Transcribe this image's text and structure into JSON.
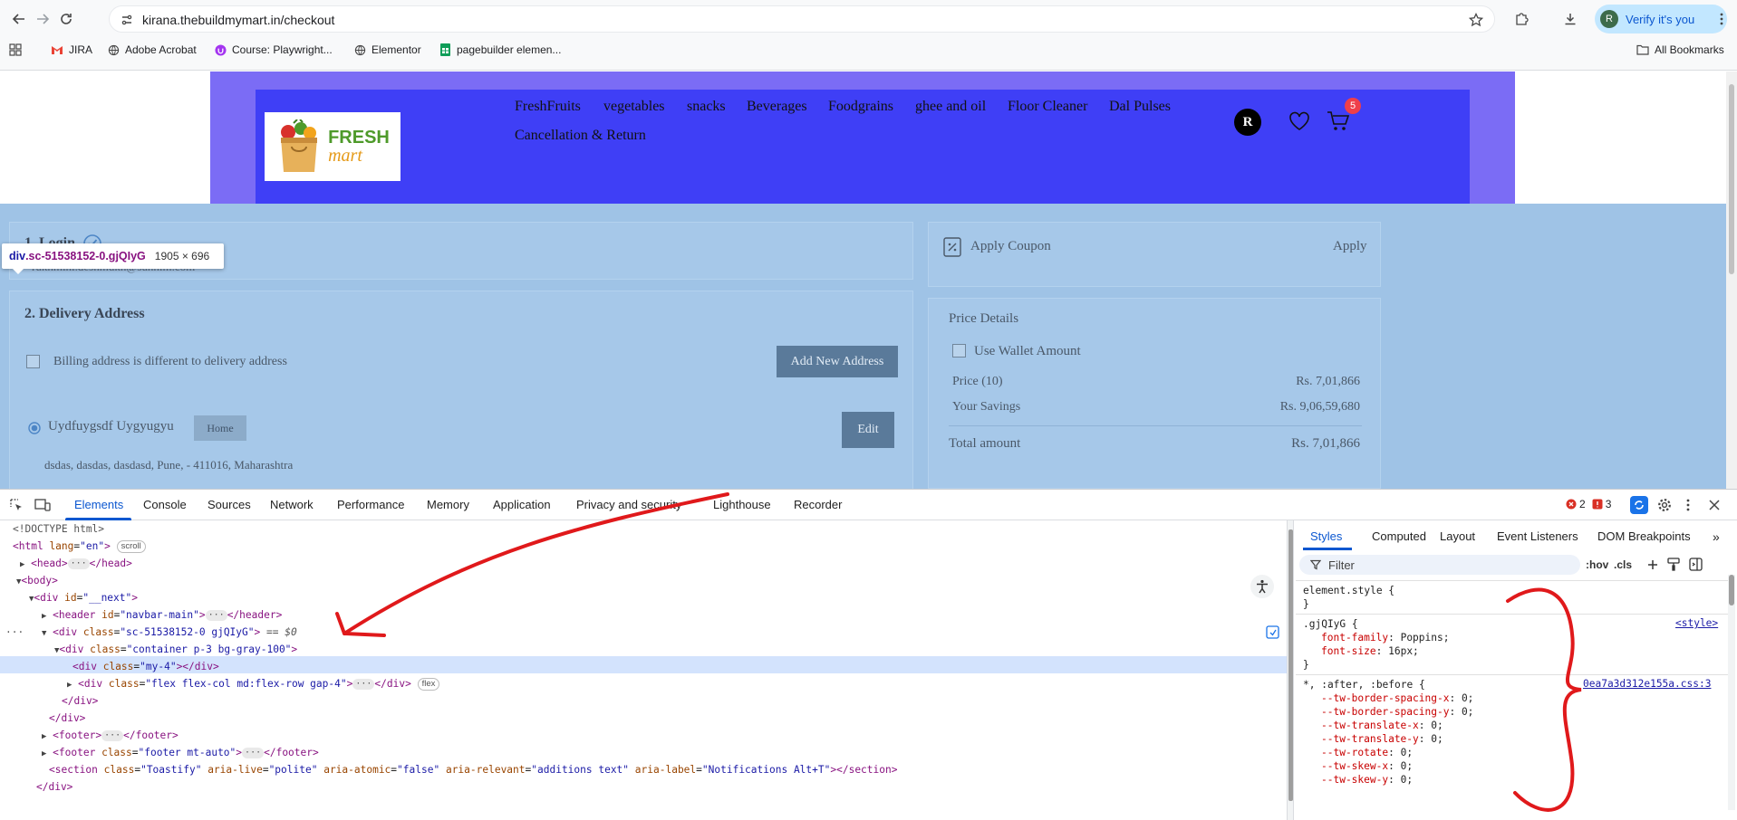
{
  "browser": {
    "url": "kirana.thebuildmymart.in/checkout",
    "verify_label": "Verify it's you",
    "profile_initial": "R",
    "bookmarks": [
      "JIRA",
      "Adobe Acrobat",
      "Course: Playwright...",
      "Elementor",
      "pagebuilder elemen..."
    ],
    "all_bookmarks": "All Bookmarks"
  },
  "site": {
    "logo_line1": "FRESH",
    "logo_line2": "mart",
    "categories": [
      "FreshFruits",
      "vegetables",
      "snacks",
      "Beverages",
      "Foodgrains",
      "ghee and oil",
      "Floor Cleaner",
      "Dal Pulses",
      "Cancellation & Return"
    ],
    "user_initial": "R",
    "cart_count": "5"
  },
  "inspect_tooltip": {
    "selector_tag": "div",
    "selector_class": ".sc-51538152-0.gjQIyG",
    "size": "1905 × 696"
  },
  "checkout": {
    "login_title": "1. Login",
    "login_email": "rukhmini.deshmukh@sunhim.com",
    "delivery_title": "2. Delivery Address",
    "billing_diff_label": "Billing address is different to delivery address",
    "add_address_label": "Add New Address",
    "address_name": "Uydfuygsdf Uygyugyu",
    "address_tag": "Home",
    "edit_label": "Edit",
    "address_line": "dsdas, dasdas, dasdasd, Pune, - 411016, Maharashtra",
    "coupon_label": "Apply Coupon",
    "apply_label": "Apply",
    "price_details_title": "Price Details",
    "wallet_label": "Use Wallet Amount",
    "price_label": "Price (10)",
    "price_value": "Rs. 7,01,866",
    "savings_label": "Your Savings",
    "savings_value": "Rs. 9,06,59,680",
    "total_label": "Total amount",
    "total_value": "Rs. 7,01,866"
  },
  "devtools": {
    "tabs": [
      "Elements",
      "Console",
      "Sources",
      "Network",
      "Performance",
      "Memory",
      "Application",
      "Privacy and security",
      "Lighthouse",
      "Recorder"
    ],
    "errors": "2",
    "warnings": "3",
    "dom_lines": {
      "l1": "<!DOCTYPE html>",
      "html_open": "<html",
      "html_attr": "lang",
      "html_val": "\"en\"",
      "scroll_chip": "scroll",
      "head": "<head>",
      "head_close": "</head>",
      "body": "<body>",
      "next_div": "<div",
      "next_attr": "id",
      "next_val": "\"__next\"",
      "header_open": "<header",
      "header_attr": "id",
      "header_val": "\"navbar-main\"",
      "header_close": "</header>",
      "sel_open": "<div",
      "sel_attr": "class",
      "sel_val": "\"sc-51538152-0 gjQIyG\"",
      "sel_eq": "== $0",
      "c1_attr": "class",
      "c1_val": "\"container p-3 bg-gray-100\"",
      "c2_val": "\"my-4\"",
      "c3_val": "\"flex flex-col md:flex-row gap-4\"",
      "flex_chip": "flex",
      "div_close": "</div>",
      "footer_open": "<footer>",
      "footer_close": "</footer>",
      "footer2_val": "\"footer mt-auto\"",
      "section_open": "<section",
      "section_class": "\"Toastify\"",
      "aria_live": "\"polite\"",
      "aria_atomic": "\"false\"",
      "aria_relevant": "\"additions text\"",
      "aria_label": "\"Notifications Alt+T\"",
      "section_close": "</section>"
    },
    "styles_tabs": [
      "Styles",
      "Computed",
      "Layout",
      "Event Listeners",
      "DOM Breakpoints"
    ],
    "filter_placeholder": "Filter",
    "hov": ":hov",
    "cls": ".cls",
    "element_style": "element.style {",
    "rule1_selector": ".gjQIyG {",
    "rule1_source": "<style>",
    "rule1_props": [
      [
        "font-family",
        "Poppins;"
      ],
      [
        "font-size",
        "16px;"
      ]
    ],
    "rule2_selector": "*, :after, :before {",
    "rule2_source": "0ea7a3d312e155a.css:3",
    "rule2_props": [
      [
        "--tw-border-spacing-x",
        "0;"
      ],
      [
        "--tw-border-spacing-y",
        "0;"
      ],
      [
        "--tw-translate-x",
        "0;"
      ],
      [
        "--tw-translate-y",
        "0;"
      ],
      [
        "--tw-rotate",
        "0;"
      ],
      [
        "--tw-skew-x",
        "0;"
      ],
      [
        "--tw-skew-y",
        "0;"
      ]
    ]
  },
  "colors": {
    "nav_bg": "#3f3ff6",
    "highlight_overlay": "#9fc3e6",
    "annotation": "#e0191b",
    "devtools_accent": "#0b57d0"
  }
}
